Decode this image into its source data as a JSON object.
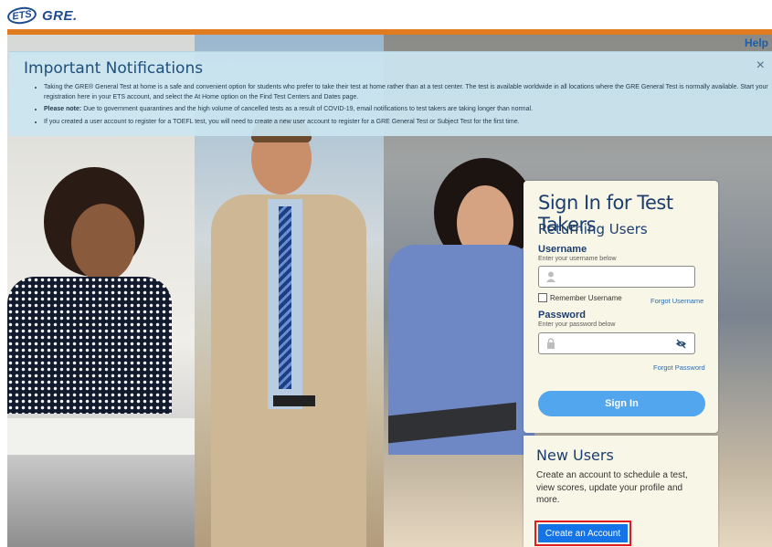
{
  "brand": {
    "ets": "ETS",
    "gre": "GRE."
  },
  "help_label": "Help",
  "notifications": {
    "title": "Important Notifications",
    "close_glyph": "×",
    "items": [
      "Taking the GRE® General Test at home is a safe and convenient option for students who prefer to take their test at home rather than at a test center. The test is available worldwide in all locations where the GRE General Test is normally available. Start your registration here in your ETS account, and select the At Home option on the Find Test Centers and Dates page.",
      "Due to government quarantines and the high volume of cancelled tests as a result of COVID-19, email notifications to test takers are taking longer than normal.",
      "If you created a user account to register for a TOEFL test, you will need to create a new user account to register for a GRE General Test or Subject Test for the first time."
    ],
    "please_note_label": "Please note:"
  },
  "signin": {
    "title": "Sign In for Test Takers",
    "returning": "Returning Users",
    "username_label": "Username",
    "username_hint": "Enter your username below",
    "remember_label": "Remember Username",
    "forgot_username": "Forgot Username",
    "password_label": "Password",
    "password_hint": "Enter your password below",
    "forgot_password": "Forgot Password",
    "signin_button": "Sign In"
  },
  "new_users": {
    "title": "New Users",
    "description": "Create an account to schedule a test, view scores, update your profile and more.",
    "create_button": "Create an Account"
  },
  "colors": {
    "accent_orange": "#e07b1f",
    "brand_blue": "#1d4b8f",
    "button_blue": "#52a6ee",
    "create_blue": "#1473e6",
    "highlight_red": "#e01a22"
  }
}
